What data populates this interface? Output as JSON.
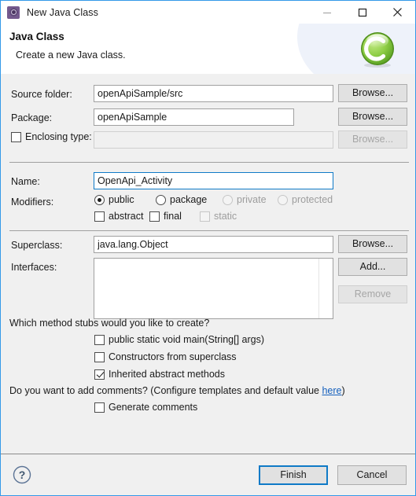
{
  "window": {
    "title": "New Java Class",
    "icon": "java-class-wizard-icon",
    "minimize_label": "—",
    "maximize_label": "□",
    "close_label": "✕"
  },
  "header": {
    "title": "Java Class",
    "subtitle": "Create a new Java class.",
    "logo": "green-c-logo"
  },
  "form": {
    "source_folder": {
      "label": "Source folder:",
      "value": "openApiSample/src",
      "browse_label": "Browse..."
    },
    "package": {
      "label": "Package:",
      "value": "openApiSample",
      "browse_label": "Browse..."
    },
    "enclosing_type": {
      "label": "Enclosing type:",
      "checked": false,
      "value": "",
      "browse_label": "Browse...",
      "disabled": true
    },
    "name": {
      "label": "Name:",
      "value": "OpenApi_Activity",
      "focused": true
    },
    "modifiers": {
      "label": "Modifiers:",
      "radios": [
        {
          "label": "public",
          "checked": true,
          "disabled": false
        },
        {
          "label": "package",
          "checked": false,
          "disabled": false
        },
        {
          "label": "private",
          "checked": false,
          "disabled": true
        },
        {
          "label": "protected",
          "checked": false,
          "disabled": true
        }
      ],
      "checkboxes": [
        {
          "label": "abstract",
          "checked": false,
          "disabled": false
        },
        {
          "label": "final",
          "checked": false,
          "disabled": false
        },
        {
          "label": "static",
          "checked": false,
          "disabled": true
        }
      ]
    },
    "superclass": {
      "label": "Superclass:",
      "value": "java.lang.Object",
      "browse_label": "Browse..."
    },
    "interfaces": {
      "label": "Interfaces:",
      "items": [],
      "add_label": "Add...",
      "remove_label": "Remove",
      "remove_disabled": true
    }
  },
  "stubs": {
    "question": "Which method stubs would you like to create?",
    "options": [
      {
        "label": "public static void main(String[] args)",
        "checked": false
      },
      {
        "label": "Constructors from superclass",
        "checked": false
      },
      {
        "label": "Inherited abstract methods",
        "checked": true
      }
    ]
  },
  "comments": {
    "question_prefix": "Do you want to add comments? (Configure templates and default value ",
    "link_label": "here",
    "question_suffix": ")",
    "option": {
      "label": "Generate comments",
      "checked": false
    }
  },
  "footer": {
    "help_label": "?",
    "finish_label": "Finish",
    "cancel_label": "Cancel"
  },
  "colors": {
    "accent": "#0f7ac7",
    "window_border": "#3399e8",
    "link": "#1560bd",
    "dialog_bg": "#f0f0f0",
    "logo_green": "#7dc242"
  }
}
